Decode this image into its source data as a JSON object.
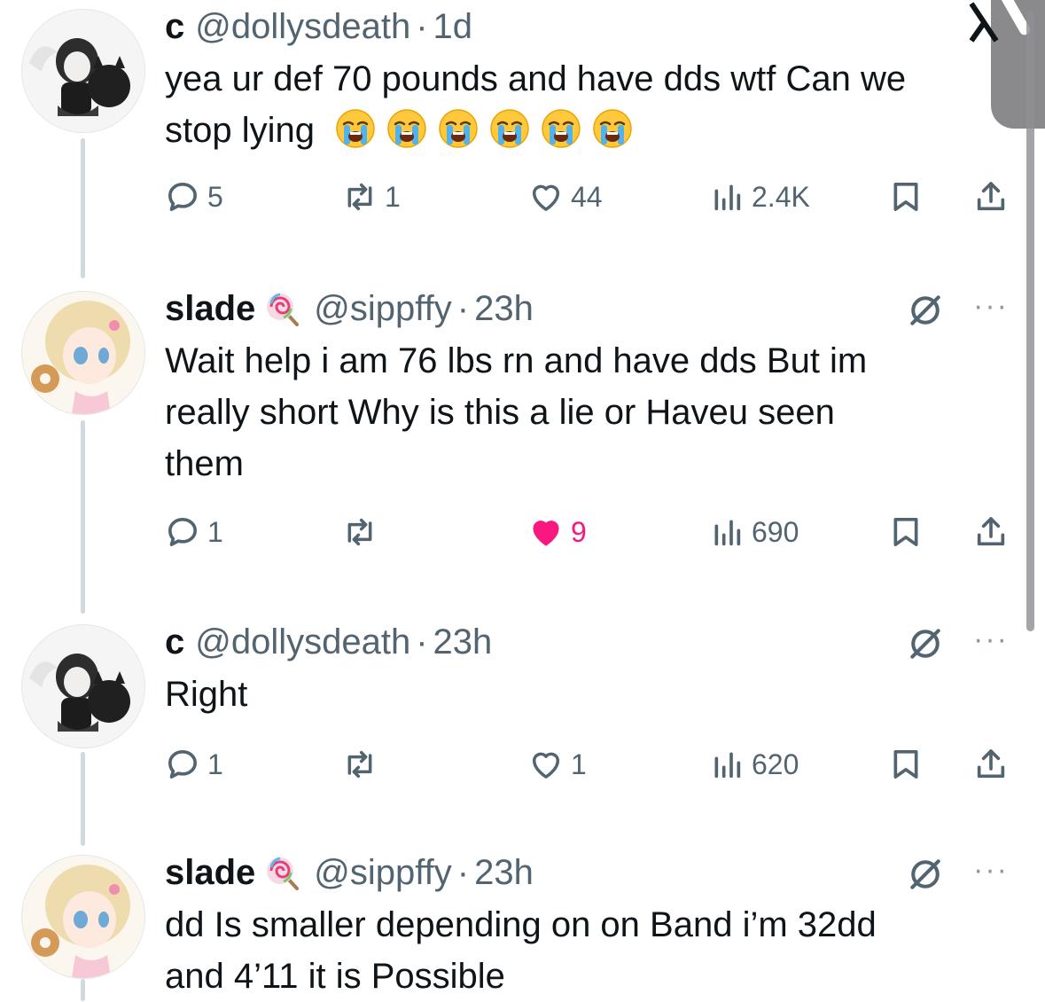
{
  "tweets": [
    {
      "name": "c",
      "handle": "@dollysdeath",
      "dot": "·",
      "time": "1d",
      "text_line1": "yea ur def 70 pounds and have dds wtf Can we",
      "text_line2": "stop lying",
      "emoji_count": 6,
      "avatar": "gothic-girl-avatar",
      "replies": "5",
      "reposts": "1",
      "likes": "44",
      "views": "2.4K",
      "liked": false
    },
    {
      "name": "slade",
      "badge": "lollipop-emoji",
      "handle": "@sippffy",
      "dot": "·",
      "time": "23h",
      "text_line1": "Wait help i am 76 lbs rn and have dds But im",
      "text_line2": "really short Why is this a lie or Haveu seen",
      "text_line3": "them",
      "avatar": "anime-blonde-girl-avatar",
      "replies": "1",
      "reposts": "",
      "likes": "9",
      "views": "690",
      "liked": true
    },
    {
      "name": "c",
      "handle": "@dollysdeath",
      "dot": "·",
      "time": "23h",
      "text_line1": "Right",
      "avatar": "gothic-girl-avatar",
      "replies": "1",
      "reposts": "",
      "likes": "1",
      "views": "620",
      "liked": false
    },
    {
      "name": "slade",
      "badge": "lollipop-emoji",
      "handle": "@sippffy",
      "dot": "·",
      "time": "23h",
      "text_line1": "dd Is smaller depending on on Band i’m 32dd",
      "text_line2": "and 4’11 it is Possible",
      "avatar": "anime-blonde-girl-avatar"
    }
  ],
  "more_label": "···",
  "colors": {
    "text": "#0f1419",
    "secondary": "#536471",
    "like_pink": "#f91880",
    "thread_line": "#cfd9de"
  }
}
